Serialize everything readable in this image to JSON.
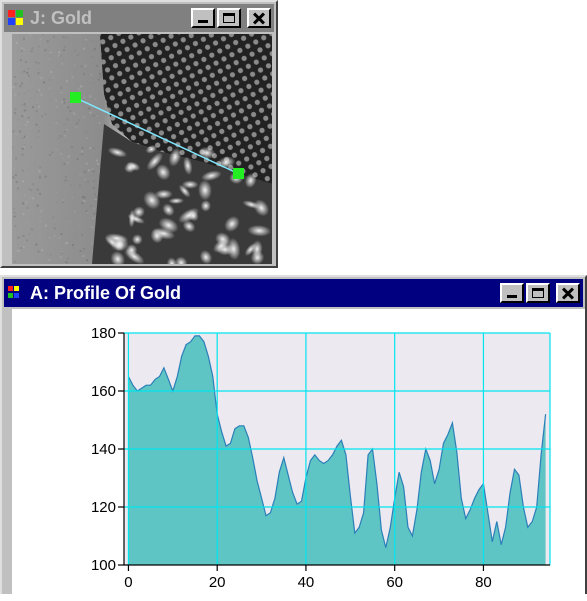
{
  "image_window": {
    "title": "J: Gold"
  },
  "profile_window": {
    "title": "A: Profile Of Gold"
  },
  "colors": {
    "active_title": "#000080",
    "inactive_title": "#808080",
    "plot_background": "#ece9f0",
    "area_fill": "#5fc4c4",
    "area_line": "#2a7fb8",
    "grid": "#00e5ee",
    "profile_line": "#7fe8ff",
    "endpoint_marker": "#22ee22"
  },
  "chart_data": {
    "type": "area",
    "title": "",
    "xlabel": "",
    "ylabel": "",
    "xlim": [
      -1,
      95
    ],
    "ylim": [
      100,
      180
    ],
    "xticks": [
      0,
      20,
      40,
      60,
      80
    ],
    "yticks": [
      100,
      120,
      140,
      160,
      180
    ],
    "grid": true,
    "x": [
      0,
      1,
      2,
      3,
      4,
      5,
      6,
      7,
      8,
      9,
      10,
      11,
      12,
      13,
      14,
      15,
      16,
      17,
      18,
      19,
      20,
      21,
      22,
      23,
      24,
      25,
      26,
      27,
      28,
      29,
      30,
      31,
      32,
      33,
      34,
      35,
      36,
      37,
      38,
      39,
      40,
      41,
      42,
      43,
      44,
      45,
      46,
      47,
      48,
      49,
      50,
      51,
      52,
      53,
      54,
      55,
      56,
      57,
      58,
      59,
      60,
      61,
      62,
      63,
      64,
      65,
      66,
      67,
      68,
      69,
      70,
      71,
      72,
      73,
      74,
      75,
      76,
      77,
      78,
      79,
      80,
      81,
      82,
      83,
      84,
      85,
      86,
      87,
      88,
      89,
      90,
      91,
      92,
      93,
      94
    ],
    "values": [
      165,
      162,
      160,
      161,
      162,
      162,
      164,
      165,
      168,
      164,
      160,
      165,
      172,
      176,
      177,
      179,
      179,
      177,
      172,
      165,
      152,
      146,
      141,
      142,
      147,
      148,
      148,
      144,
      137,
      129,
      123,
      117,
      118,
      123,
      132,
      137,
      131,
      125,
      121,
      122,
      130,
      136,
      138,
      136,
      135,
      136,
      138,
      141,
      143,
      138,
      124,
      111,
      113,
      118,
      138,
      140,
      128,
      112,
      106,
      113,
      123,
      132,
      127,
      113,
      110,
      119,
      132,
      140,
      136,
      128,
      133,
      142,
      145,
      149,
      139,
      123,
      116,
      119,
      123,
      126,
      128,
      118,
      108,
      115,
      107,
      113,
      125,
      133,
      131,
      120,
      113,
      115,
      120,
      138,
      152
    ]
  }
}
